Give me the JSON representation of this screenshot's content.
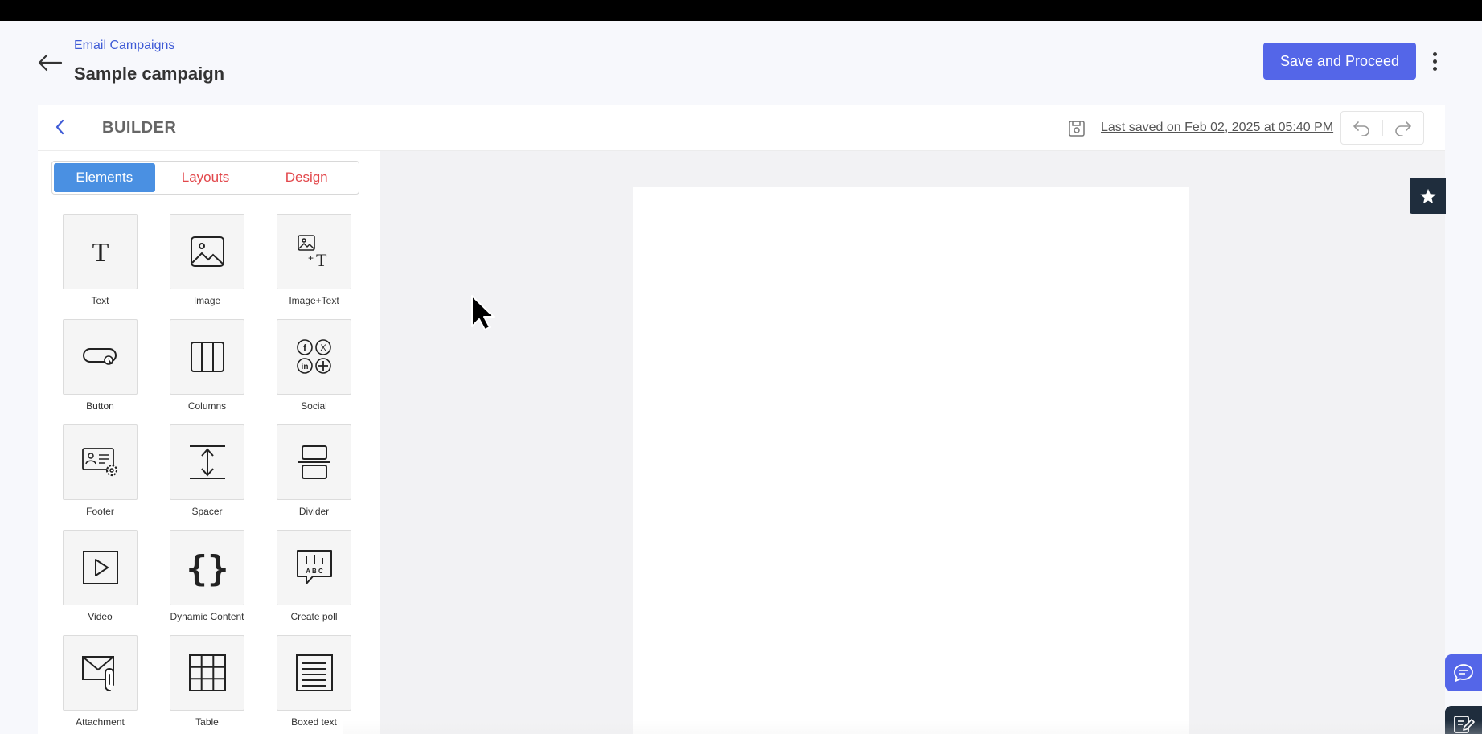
{
  "header": {
    "breadcrumb": "Email Campaigns",
    "title": "Sample campaign",
    "save_button": "Save and Proceed"
  },
  "builder": {
    "title": "BUILDER",
    "last_saved": "Last saved on Feb 02, 2025 at 05:40 PM"
  },
  "sidebar": {
    "tabs": [
      {
        "label": "Elements",
        "active": true
      },
      {
        "label": "Layouts",
        "active": false
      },
      {
        "label": "Design",
        "active": false
      }
    ],
    "elements": [
      {
        "label": "Text",
        "icon": "text-icon"
      },
      {
        "label": "Image",
        "icon": "image-icon"
      },
      {
        "label": "Image+Text",
        "icon": "image-text-icon"
      },
      {
        "label": "Button",
        "icon": "button-icon"
      },
      {
        "label": "Columns",
        "icon": "columns-icon"
      },
      {
        "label": "Social",
        "icon": "social-icon"
      },
      {
        "label": "Footer",
        "icon": "footer-icon"
      },
      {
        "label": "Spacer",
        "icon": "spacer-icon"
      },
      {
        "label": "Divider",
        "icon": "divider-icon"
      },
      {
        "label": "Video",
        "icon": "video-icon"
      },
      {
        "label": "Dynamic Content",
        "icon": "dynamic-content-icon"
      },
      {
        "label": "Create poll",
        "icon": "poll-icon"
      },
      {
        "label": "Attachment",
        "icon": "attachment-icon"
      },
      {
        "label": "Table",
        "icon": "table-icon"
      },
      {
        "label": "Boxed text",
        "icon": "boxed-text-icon"
      }
    ]
  },
  "colors": {
    "primary": "#5466e8",
    "active_tab": "#4a90e2",
    "tab_text": "#e2474b",
    "link": "#3f5bd6",
    "dark_button": "#1f2d3d"
  }
}
